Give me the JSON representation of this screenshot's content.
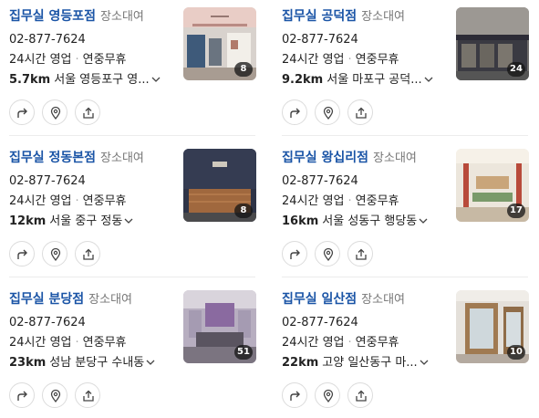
{
  "listings": [
    {
      "name": "집무실 영등포점",
      "category": "장소대여",
      "phone": "02-877-7624",
      "hours": "24시간 영업",
      "holiday": "연중무휴",
      "distance": "5.7km",
      "address": "서울 영등포구 영...",
      "photo_count": "8",
      "photo_theme": "office-interior-pink-ceiling"
    },
    {
      "name": "집무실 공덕점",
      "category": "장소대여",
      "phone": "02-877-7624",
      "hours": "24시간 영업",
      "holiday": "연중무휴",
      "distance": "9.2km",
      "address": "서울 마포구 공덕...",
      "photo_count": "24",
      "photo_theme": "storefront-dark"
    },
    {
      "name": "집무실 정동본점",
      "category": "장소대여",
      "phone": "02-877-7624",
      "hours": "24시간 영업",
      "holiday": "연중무휴",
      "distance": "12km",
      "address": "서울 중구 정동",
      "photo_count": "8",
      "photo_theme": "reception-navy-wood"
    },
    {
      "name": "집무실 왕십리점",
      "category": "장소대여",
      "phone": "02-877-7624",
      "hours": "24시간 영업",
      "holiday": "연중무휴",
      "distance": "16km",
      "address": "서울 성동구 행당동",
      "photo_count": "17",
      "photo_theme": "lounge-red-pillars"
    },
    {
      "name": "집무실 분당점",
      "category": "장소대여",
      "phone": "02-877-7624",
      "hours": "24시간 영업",
      "holiday": "연중무휴",
      "distance": "23km",
      "address": "성남 분당구 수내동",
      "photo_count": "51",
      "photo_theme": "lounge-purple-sofa"
    },
    {
      "name": "집무실 일산점",
      "category": "장소대여",
      "phone": "02-877-7624",
      "hours": "24시간 영업",
      "holiday": "연중무휴",
      "distance": "22km",
      "address": "고양 일산동구 마...",
      "photo_count": "10",
      "photo_theme": "booth-glass-wood"
    }
  ],
  "actions": [
    "directions-icon",
    "location-pin-icon",
    "share-icon"
  ],
  "colors": {
    "name": "#1a54a6",
    "category": "#777777",
    "badge": "#1e1e1e"
  }
}
